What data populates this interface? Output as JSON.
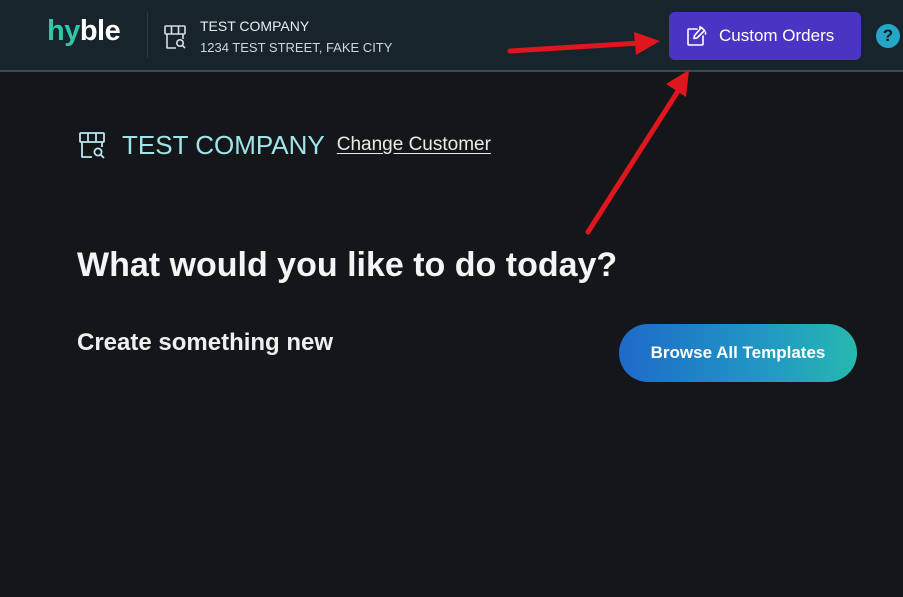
{
  "header": {
    "logo_part1": "hy",
    "logo_part2": "ble",
    "company_name": "TEST COMPANY",
    "company_address": "1234 TEST STREET, FAKE CITY",
    "custom_orders_label": "Custom Orders",
    "help_label": "?"
  },
  "customer": {
    "name": "TEST COMPANY",
    "change_label": "Change Customer"
  },
  "main": {
    "heading": "What would you like to do today?",
    "subheading": "Create something new",
    "browse_label": "Browse All Templates"
  },
  "icons": {
    "store": "store-icon",
    "custom_orders": "edit-document-icon",
    "help": "help-icon",
    "customer": "store-icon"
  },
  "colors": {
    "brand_teal": "#2fc7a6",
    "header_bg": "#17242c",
    "page_bg": "#141619",
    "custom_orders_bg": "#4a34c4",
    "customer_title": "#9fe3ec",
    "annotation_arrow": "#e0161e"
  }
}
